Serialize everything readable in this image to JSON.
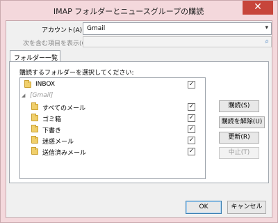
{
  "window": {
    "title": "IMAP フォルダーとニュースグループの購読",
    "close_icon": "✕"
  },
  "account": {
    "label": "アカウント(A):",
    "value": "Gmail"
  },
  "display_filter": {
    "label": "次を含む項目を表示(Q):"
  },
  "tab": {
    "label": "フォルダー一覧(L)"
  },
  "folder_list": {
    "instruction": "購読するフォルダーを選択してください:",
    "items": [
      {
        "name": "INBOX",
        "checked": "✓"
      },
      {
        "name": "[Gmail]",
        "toggle": "◢"
      },
      {
        "name": "すべてのメール",
        "checked": "✓"
      },
      {
        "name": "ゴミ箱",
        "checked": "✓"
      },
      {
        "name": "下書き",
        "checked": "✓"
      },
      {
        "name": "迷惑メール",
        "checked": "✓"
      },
      {
        "name": "送信済みメール",
        "checked": "✓"
      }
    ]
  },
  "buttons": {
    "subscribe": "購読(S)",
    "unsubscribe": "購読を解除(U)",
    "update": "更新(R)",
    "stop": "中止(T)",
    "ok": "OK",
    "cancel": "キャンセル"
  }
}
